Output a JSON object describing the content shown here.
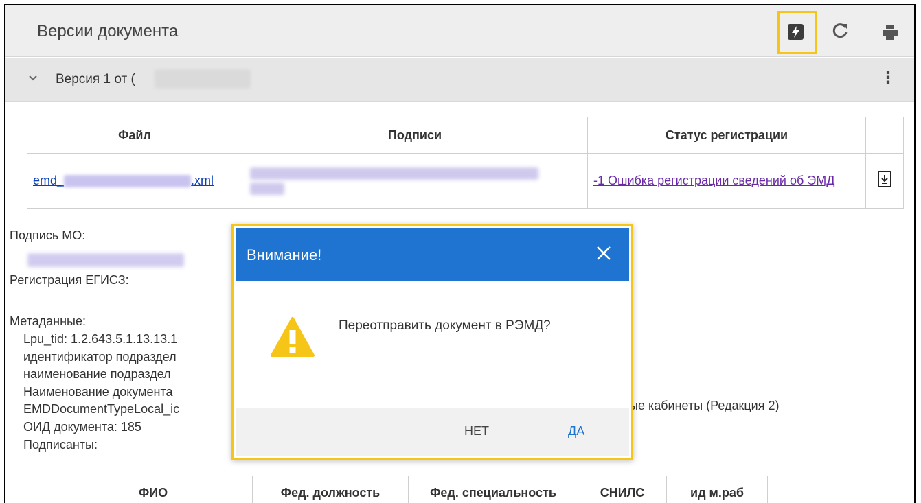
{
  "header": {
    "title": "Версии документа"
  },
  "toolbar": {
    "icons": [
      "flash-icon",
      "refresh-icon",
      "print-icon"
    ]
  },
  "version": {
    "label": "Версия 1 от ("
  },
  "files_table": {
    "columns": [
      "Файл",
      "Подписи",
      "Статус регистрации"
    ],
    "row": {
      "file_prefix": "emd_",
      "file_suffix": ".xml",
      "status": "-1 Ошибка регистрации сведений об ЭМД"
    }
  },
  "meta": {
    "mo_signature_label": "Подпись МО:",
    "egisz_label": "Регистрация ЕГИСЗ:",
    "metadata_label": "Метаданные:",
    "lpu_tid": "Lpu_tid: 1.2.643.5.1.13.13.1",
    "dept_id": "идентификатор подраздел",
    "dept_name": "наименование подраздел",
    "doc_name": "Наименование документа",
    "doc_name_tail": "ые кабинеты (Редакция 2)",
    "emd_type": "EMDDocumentTypeLocal_ic",
    "oid": "ОИД документа: 185",
    "signers_label": "Подписанты:"
  },
  "signers_table": {
    "columns": [
      "ФИО",
      "Фед. должность",
      "Фед. специальность",
      "СНИЛС",
      "ид м.раб"
    ]
  },
  "dialog": {
    "title": "Внимание!",
    "message": "Переотправить документ в РЭМД?",
    "no_label": "НЕТ",
    "yes_label": "ДА"
  },
  "colors": {
    "accent": "#1e74d0",
    "highlight": "#f5c518",
    "warning": "#f5c518"
  }
}
